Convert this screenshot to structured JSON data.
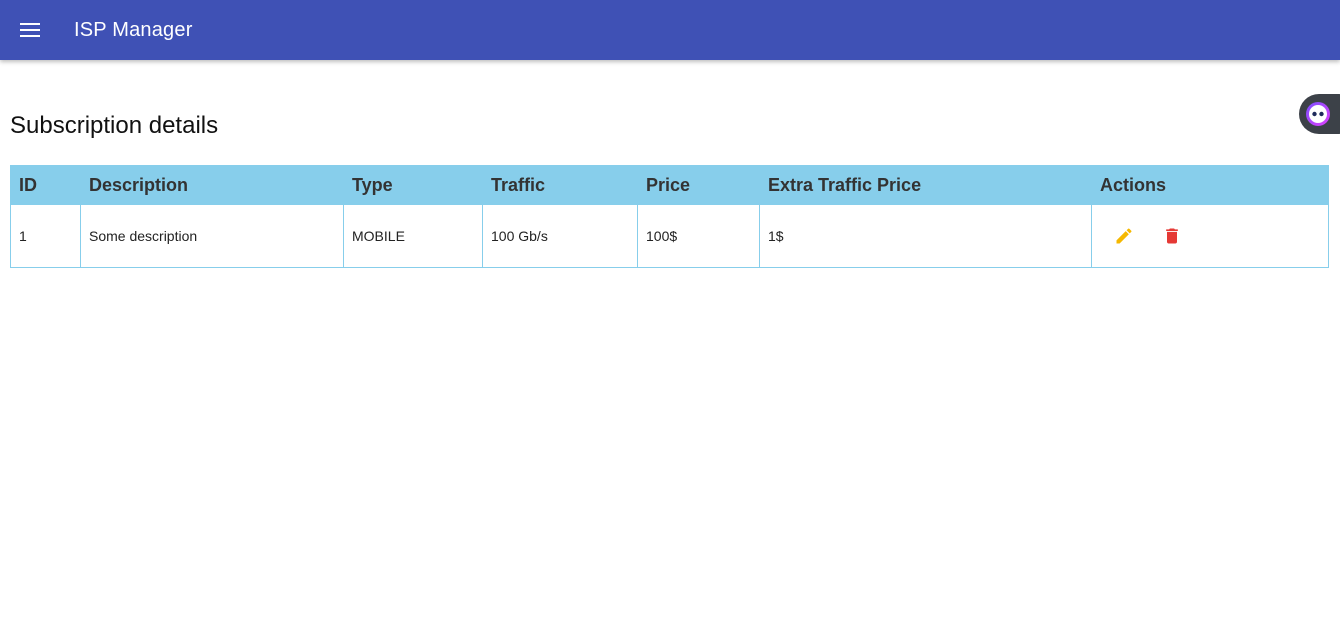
{
  "app_bar": {
    "menu_icon": "hamburger-menu-icon",
    "title": "ISP Manager",
    "background_color": "#3f51b5"
  },
  "page": {
    "title": "Subscription details"
  },
  "table": {
    "header_color": "#87ceeb",
    "columns": [
      "ID",
      "Description",
      "Type",
      "Traffic",
      "Price",
      "Extra Traffic Price",
      "Actions"
    ],
    "rows": [
      {
        "id": "1",
        "description": "Some description",
        "type": "MOBILE",
        "traffic": "100 Gb/s",
        "price": "100$",
        "extra_traffic_price": "1$",
        "actions": {
          "edit_icon": "pencil-icon",
          "edit_color": "#f5b800",
          "delete_icon": "trash-icon",
          "delete_color": "#e53935"
        }
      }
    ]
  },
  "floating_widget": {
    "icon": "assistant-face-icon"
  }
}
